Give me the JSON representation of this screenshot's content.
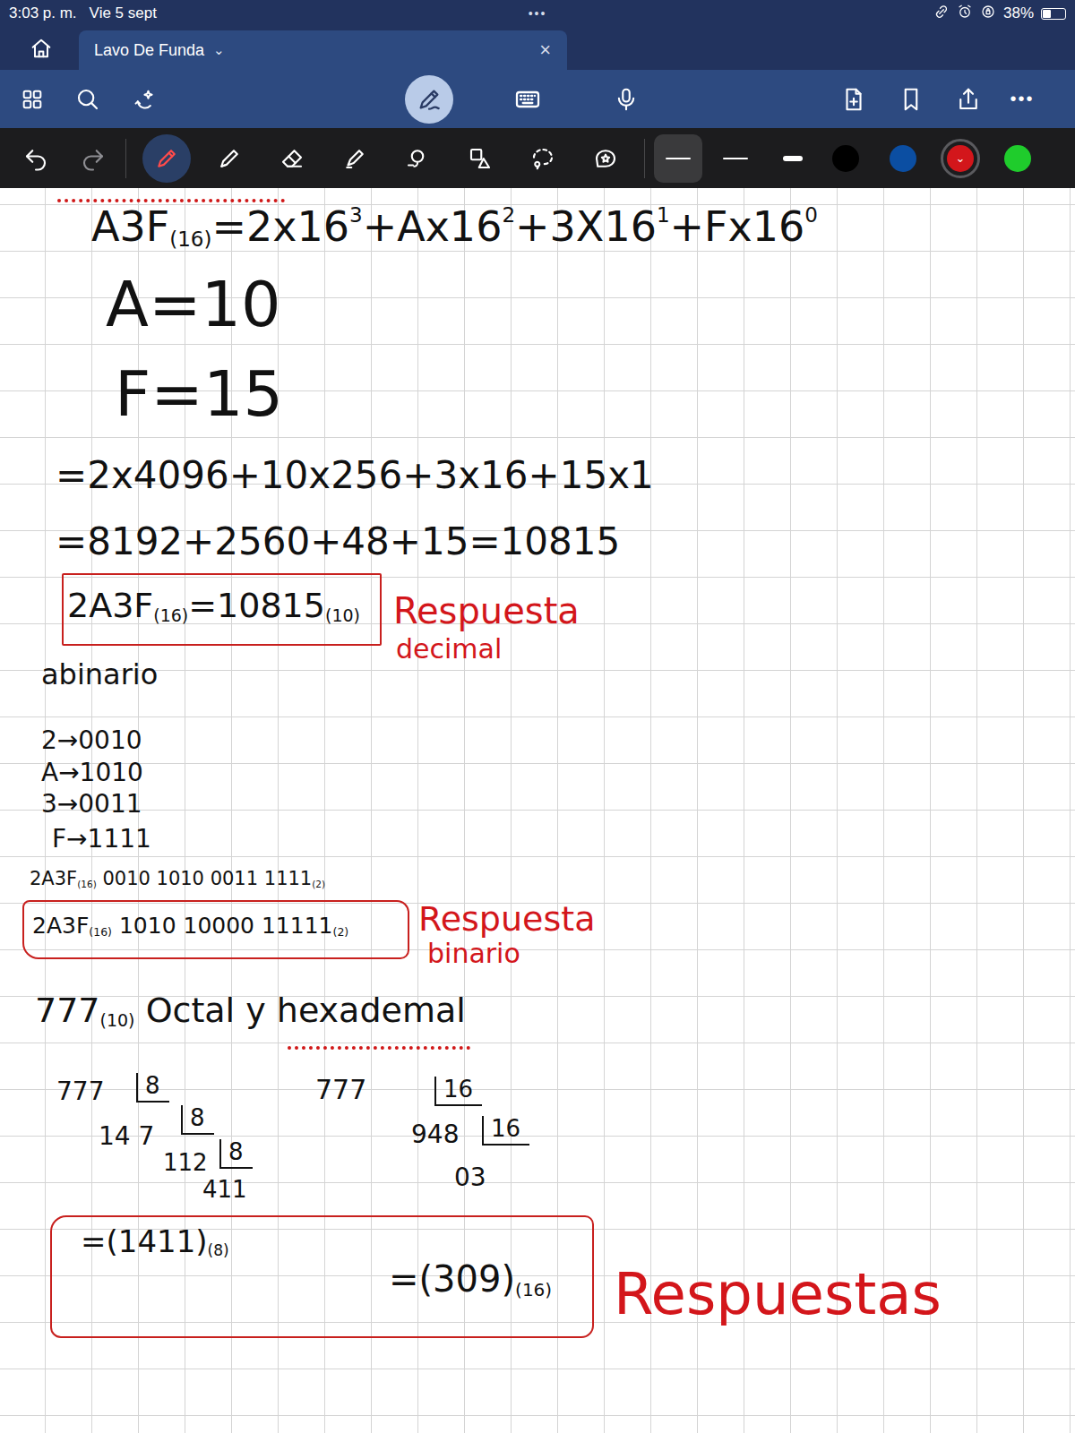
{
  "status_bar": {
    "time": "3:03 p. m.",
    "date": "Vie 5 sept",
    "dots": "•••",
    "battery": "38%",
    "battery_level": 0.38
  },
  "tab": {
    "label": "Lavo De Funda",
    "chevron": "⌄",
    "close": "×"
  },
  "toolbar": {
    "draw_mode_selected": true,
    "more": "•••"
  },
  "pen_tools": [
    {
      "kind": "pen",
      "selected": true
    },
    {
      "kind": "pencil",
      "selected": false
    },
    {
      "kind": "eraser",
      "selected": false
    },
    {
      "kind": "highlighter",
      "selected": false
    },
    {
      "kind": "shapes",
      "selected": false
    },
    {
      "kind": "convert",
      "selected": false
    },
    {
      "kind": "lasso",
      "selected": false
    },
    {
      "kind": "sticker",
      "selected": false
    }
  ],
  "thickness": [
    {
      "selected": true
    },
    {
      "selected": false
    },
    {
      "selected": false
    }
  ],
  "colors": [
    {
      "color": "#000000",
      "selected": false
    },
    {
      "color": "#0b4ea2",
      "selected": false
    },
    {
      "color": "#d3161b",
      "selected": true,
      "chevron": "⌄"
    },
    {
      "color": "#1fcc2c",
      "selected": false
    }
  ],
  "ink": [
    {
      "kind": "line",
      "color": "#111111",
      "parts": [
        {
          "text": "A3F",
          "kind": "text"
        },
        {
          "text": "(16)",
          "kind": "sub"
        },
        {
          "text": "=2x16",
          "kind": "text"
        },
        {
          "text": "3",
          "kind": "sup"
        },
        {
          "text": "+Ax16",
          "kind": "text"
        },
        {
          "text": "2",
          "kind": "sup"
        },
        {
          "text": "+3X16",
          "kind": "text"
        },
        {
          "text": "1",
          "kind": "sup"
        },
        {
          "text": "+Fx16",
          "kind": "text"
        },
        {
          "text": "0",
          "kind": "sup"
        }
      ]
    },
    {
      "kind": "line",
      "color": "#111111",
      "parts": [
        {
          "text": "A=10",
          "kind": "text"
        }
      ]
    },
    {
      "kind": "line",
      "color": "#111111",
      "parts": [
        {
          "text": "F=15",
          "kind": "text"
        }
      ]
    },
    {
      "kind": "line",
      "color": "#111111",
      "parts": [
        {
          "text": "=2x4096+10x256+3x16+15x1",
          "kind": "text"
        }
      ]
    },
    {
      "kind": "line",
      "color": "#111111",
      "parts": [
        {
          "text": "=8192+2560+48+15=10815",
          "kind": "text"
        }
      ]
    },
    {
      "kind": "line",
      "color": "#111111",
      "parts": [
        {
          "text": "2A3F",
          "kind": "text"
        },
        {
          "text": "(16)",
          "kind": "sub"
        },
        {
          "text": "=10815",
          "kind": "text"
        },
        {
          "text": "(10)",
          "kind": "sub"
        }
      ]
    },
    {
      "kind": "line",
      "color": "#d3161b",
      "parts": [
        {
          "text": "Respuesta",
          "kind": "text"
        }
      ]
    },
    {
      "kind": "line",
      "color": "#d3161b",
      "parts": [
        {
          "text": "decimal",
          "kind": "text"
        }
      ]
    },
    {
      "kind": "line",
      "color": "#111111",
      "parts": [
        {
          "text": "abinario",
          "kind": "text"
        }
      ]
    },
    {
      "kind": "line",
      "color": "#111111",
      "parts": [
        {
          "text": "2→0010",
          "kind": "text"
        }
      ]
    },
    {
      "kind": "line",
      "color": "#111111",
      "parts": [
        {
          "text": "A→1010",
          "kind": "text"
        }
      ]
    },
    {
      "kind": "line",
      "color": "#111111",
      "parts": [
        {
          "text": "3→0011",
          "kind": "text"
        }
      ]
    },
    {
      "kind": "line",
      "color": "#111111",
      "parts": [
        {
          "text": "F→1111",
          "kind": "text"
        }
      ]
    },
    {
      "kind": "line",
      "color": "#111111",
      "parts": [
        {
          "text": "2A3F",
          "kind": "text"
        },
        {
          "text": "(16)",
          "kind": "sub"
        },
        {
          "text": " 0010 1010 0011 1111",
          "kind": "text"
        },
        {
          "text": "(2)",
          "kind": "sub"
        }
      ]
    },
    {
      "kind": "line",
      "color": "#111111",
      "parts": [
        {
          "text": "2A3F",
          "kind": "text"
        },
        {
          "text": "(16)",
          "kind": "sub"
        },
        {
          "text": " 1010 10000 11111",
          "kind": "text"
        },
        {
          "text": "(2)",
          "kind": "sub"
        }
      ]
    },
    {
      "kind": "line",
      "color": "#d3161b",
      "parts": [
        {
          "text": "Respuesta",
          "kind": "text"
        }
      ]
    },
    {
      "kind": "line",
      "color": "#d3161b",
      "parts": [
        {
          "text": "binario",
          "kind": "text"
        }
      ]
    },
    {
      "kind": "line",
      "color": "#111111",
      "parts": [
        {
          "text": "777",
          "kind": "text"
        },
        {
          "text": "(10)",
          "kind": "sub"
        },
        {
          "text": " Octal y hexademal",
          "kind": "text"
        }
      ]
    },
    {
      "kind": "line",
      "color": "#111111",
      "parts": [
        {
          "text": "777",
          "kind": "text"
        }
      ]
    },
    {
      "kind": "divisor",
      "color": "#111111",
      "parts": [
        {
          "text": "8",
          "kind": "text"
        }
      ]
    },
    {
      "kind": "line",
      "color": "#111111",
      "parts": [
        {
          "text": "14 7",
          "kind": "text"
        }
      ]
    },
    {
      "kind": "divisor",
      "color": "#111111",
      "parts": [
        {
          "text": "8",
          "kind": "text"
        }
      ]
    },
    {
      "kind": "line",
      "color": "#111111",
      "parts": [
        {
          "text": "112",
          "kind": "text"
        }
      ]
    },
    {
      "kind": "divisor",
      "color": "#111111",
      "parts": [
        {
          "text": "8",
          "kind": "text"
        }
      ]
    },
    {
      "kind": "line",
      "color": "#111111",
      "parts": [
        {
          "text": "411",
          "kind": "text"
        }
      ]
    },
    {
      "kind": "line",
      "color": "#111111",
      "parts": [
        {
          "text": "777",
          "kind": "text"
        }
      ]
    },
    {
      "kind": "divisor",
      "color": "#111111",
      "parts": [
        {
          "text": "16",
          "kind": "text"
        }
      ]
    },
    {
      "kind": "line",
      "color": "#111111",
      "parts": [
        {
          "text": "948",
          "kind": "text"
        }
      ]
    },
    {
      "kind": "divisor",
      "color": "#111111",
      "parts": [
        {
          "text": "16",
          "kind": "text"
        }
      ]
    },
    {
      "kind": "line",
      "color": "#111111",
      "parts": [
        {
          "text": "03",
          "kind": "text"
        }
      ]
    },
    {
      "kind": "line",
      "color": "#111111",
      "parts": [
        {
          "text": "=(1411)",
          "kind": "text"
        },
        {
          "text": "(8)",
          "kind": "sub"
        }
      ]
    },
    {
      "kind": "line",
      "color": "#111111",
      "parts": [
        {
          "text": "=(309)",
          "kind": "text"
        },
        {
          "text": "(16)",
          "kind": "sub"
        }
      ]
    },
    {
      "kind": "line",
      "color": "#d3161b",
      "parts": [
        {
          "text": "Respuestas",
          "kind": "text"
        }
      ]
    }
  ]
}
